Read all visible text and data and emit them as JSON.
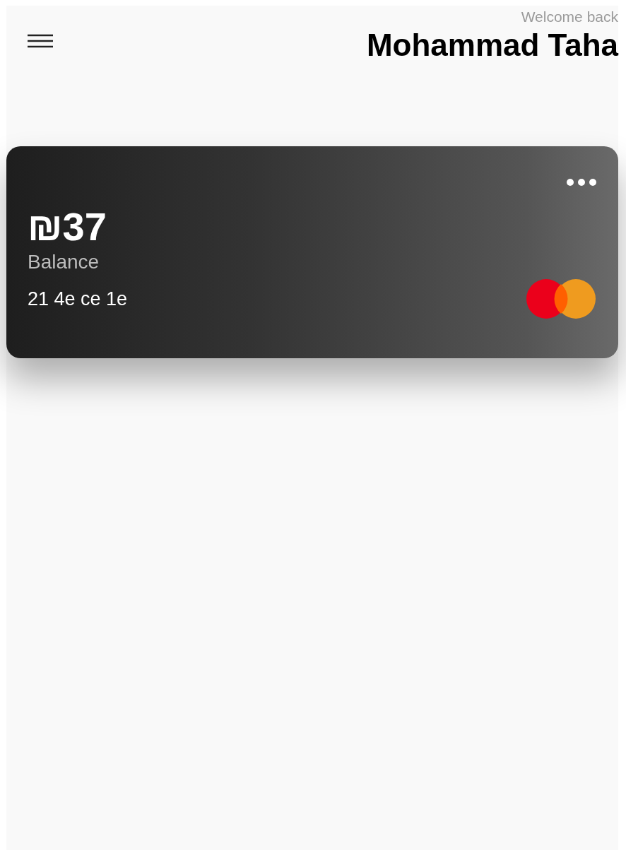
{
  "header": {
    "greeting": "Welcome back",
    "name": "Mohammad Taha"
  },
  "card": {
    "amount": "₪37",
    "label": "Balance",
    "card_id": "21 4e ce 1e"
  }
}
